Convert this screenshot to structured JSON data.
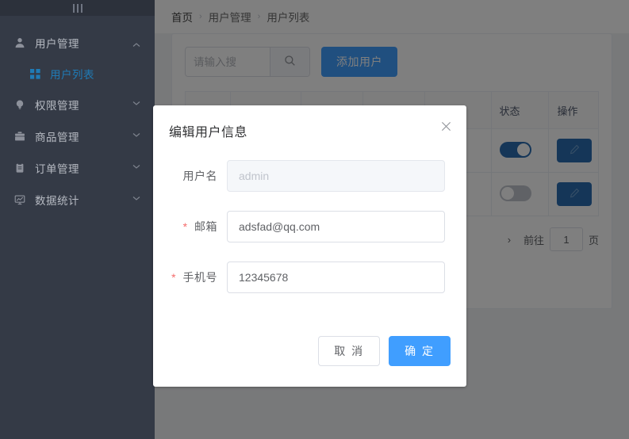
{
  "sidebar": {
    "toggle_icon": "menu-bars-icon",
    "menu": [
      {
        "label": "用户管理",
        "icon": "user-icon",
        "expanded": true,
        "children": [
          {
            "label": "用户列表",
            "icon": "grid-icon",
            "active": true
          }
        ]
      },
      {
        "label": "权限管理",
        "icon": "bulb-icon",
        "expanded": false
      },
      {
        "label": "商品管理",
        "icon": "briefcase-icon",
        "expanded": false
      },
      {
        "label": "订单管理",
        "icon": "clipboard-icon",
        "expanded": false
      },
      {
        "label": "数据统计",
        "icon": "chart-board-icon",
        "expanded": false
      }
    ]
  },
  "breadcrumb": {
    "items": [
      "首页",
      "用户管理",
      "用户列表"
    ],
    "separator": "›"
  },
  "toolbar": {
    "search_placeholder": "请输入搜",
    "search_value": "",
    "search_icon": "search-icon",
    "add_button": "添加用户"
  },
  "table": {
    "columns": [
      "",
      "",
      "",
      "",
      "",
      "状态",
      "操作"
    ],
    "status_header": "状态",
    "action_header": "操作",
    "rows": [
      {
        "status_on": true,
        "action_icon": "edit-pencil-icon"
      },
      {
        "status_on": false,
        "action_icon": "edit-pencil-icon"
      }
    ]
  },
  "pagination": {
    "next_arrow": "›",
    "jump_label": "前往",
    "page_value": "1",
    "page_unit": "页"
  },
  "dialog": {
    "title": "编辑用户信息",
    "close_icon": "close-icon",
    "fields": [
      {
        "label": "用户名",
        "required": false,
        "value": "",
        "placeholder": "admin",
        "disabled": true
      },
      {
        "label": "邮箱",
        "required": true,
        "value": "adsfad@qq.com",
        "placeholder": "",
        "disabled": false
      },
      {
        "label": "手机号",
        "required": true,
        "value": "12345678",
        "placeholder": "",
        "disabled": false
      }
    ],
    "cancel_button": "取 消",
    "confirm_button": "确 定"
  },
  "colors": {
    "sidebar_bg": "#343a46",
    "sidebar_header_bg": "#2c313b",
    "active_blue": "#1f7bb6",
    "primary_blue": "#409eff",
    "required_red": "#f56c6c"
  }
}
